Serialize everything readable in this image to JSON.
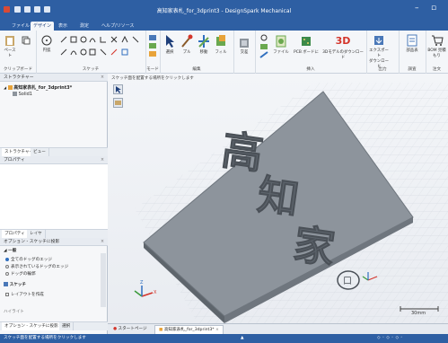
{
  "window": {
    "title": "高知家表札_for_3dprint3 - DesignSpark Mechanical",
    "logo_glyph": "✎"
  },
  "menu": {
    "tabs": [
      "ファイル",
      "デザイン",
      "表示",
      "測定",
      "ヘルプ/リソース"
    ],
    "active_index": 1
  },
  "ribbon": {
    "groups": [
      {
        "label": "クリップボード",
        "buttons": [
          "ペースト"
        ]
      },
      {
        "label": "スケッチ",
        "buttons": [
          "円弧"
        ]
      },
      {
        "label": "モード",
        "buttons": []
      },
      {
        "label": "編集",
        "buttons": [
          "選択",
          "プル",
          "移動",
          "フィル"
        ]
      },
      {
        "label": "",
        "buttons": [
          "交差"
        ]
      },
      {
        "label": "挿入",
        "buttons": [
          "ファイル",
          "PCB ボードに",
          "3Dモデルのダウンロード"
        ]
      },
      {
        "label": "出力",
        "buttons": [
          "エクスポート",
          "ダウンロード"
        ]
      },
      {
        "label": "調査",
        "buttons": [
          "部品表"
        ]
      },
      {
        "label": "注文",
        "buttons": [
          "BOM 見積もり"
        ]
      }
    ],
    "three_d_label": "3D"
  },
  "structure_panel": {
    "title": "ストラクチャー",
    "root_item": "高知家表札_for_3dprint3*",
    "child_item": "Solid1",
    "tabs": [
      "ストラクチャー",
      "ビュー"
    ]
  },
  "properties_panel": {
    "title": "プロパティ",
    "tabs": [
      "プロパティ",
      "レイヤ"
    ]
  },
  "options_panel": {
    "title": "オプション - スケッチに投影",
    "section": "一般",
    "radio_options": [
      "全てのドッグのエッジ",
      "表示されているドッグのエッジ",
      "ドッグの輪郭"
    ],
    "selected_radio": 0,
    "section2": "スケッチ",
    "checkbox_label": "レイアウトを作成",
    "footer_item": "ハイライト"
  },
  "viewport": {
    "hint": "スケッチ面を配置する場所をクリックします",
    "plate_text": [
      "高",
      "知",
      "家"
    ],
    "scale_label": "30mm"
  },
  "doc_tabs": {
    "start_tab": "スタートページ",
    "model_tab": "高知家表札_for_3dprint3*"
  },
  "status": {
    "left": "スケッチ面を配置する場所をクリックします",
    "mode": "オプション - スケッチに投影",
    "select": "選択"
  },
  "colors": {
    "title_bar": "#2e5fa3",
    "plate": "#8d949c",
    "accent_red": "#d4352b"
  }
}
